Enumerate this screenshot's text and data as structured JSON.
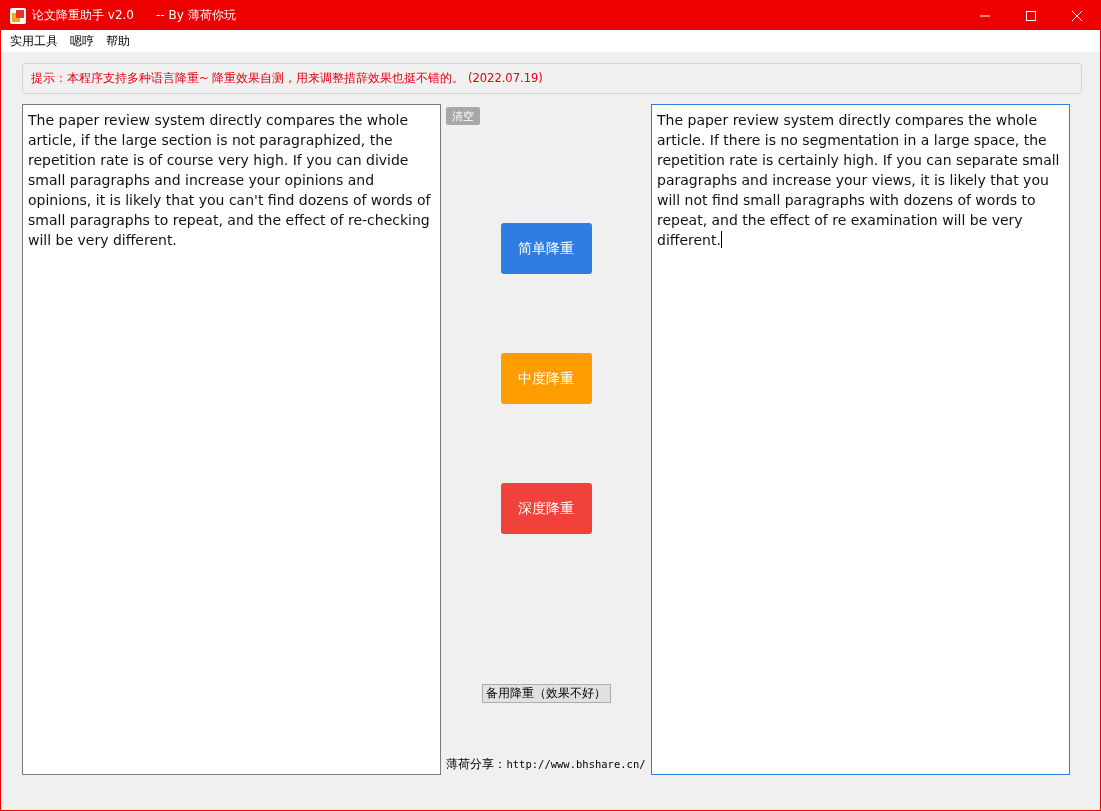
{
  "window": {
    "title": "论文降重助手 v2.0",
    "subtitle": "-- By 薄荷你玩"
  },
  "menu": [
    "实用工具",
    "嗯哼",
    "帮助"
  ],
  "notice": "提示：本程序支持多种语言降重~  降重效果自测，用来调整措辞效果也挺不错的。 (2022.07.19)",
  "input": {
    "value": "The paper review system directly compares the whole article, if the large section is not paragraphized, the repetition rate is of course very high.  If you can divide small paragraphs and increase your opinions and opinions, it is likely that you can't find dozens of words of small paragraphs to repeat, and the effect of re-checking will be very different."
  },
  "clear_button": {
    "label": "清空",
    "disabled": true
  },
  "actions": [
    {
      "label": "简单降重",
      "color": "#2f7de1"
    },
    {
      "label": "中度降重",
      "color": "#ff9d00"
    },
    {
      "label": "深度降重",
      "color": "#f0413b"
    }
  ],
  "backup_button": "备用降重（效果不好）",
  "share": {
    "label": "薄荷分享：",
    "url": "http://www.bhshare.cn/"
  },
  "output": {
    "value": "The paper review system directly compares the whole article. If there is no segmentation in a large space, the repetition rate is certainly high. If you can separate small paragraphs and increase your views, it is likely that you will not find small paragraphs with dozens of words to repeat, and the effect of re examination will be very different.",
    "focused": true
  }
}
